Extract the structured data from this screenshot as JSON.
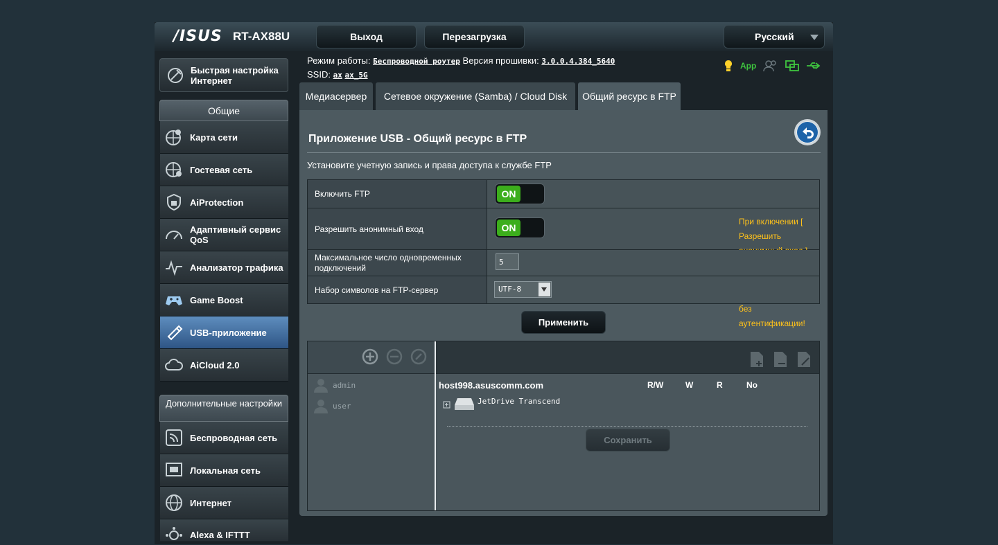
{
  "header": {
    "brand": "/ISUS",
    "model": "RT-AX88U",
    "logout": "Выход",
    "reboot": "Перезагрузка",
    "language": "Русский"
  },
  "info": {
    "mode_label": "Режим работы:",
    "mode_value": "Беспроводной роутер",
    "fw_label": "Версия прошивки:",
    "fw_value": "3.0.0.4.384_5640",
    "ssid_label": "SSID:",
    "ssid_1": "ax",
    "ssid_2": "ax_5G",
    "app": "App"
  },
  "sidebar": {
    "quick_setup": "Быстрая настройка Интернет",
    "general_header": "Общие",
    "general_items": [
      {
        "label": "Карта сети",
        "icon": "network-map-icon"
      },
      {
        "label": "Гостевая сеть",
        "icon": "guest-network-icon"
      },
      {
        "label": "AiProtection",
        "icon": "shield-icon"
      },
      {
        "label": "Адаптивный сервис QoS",
        "icon": "qos-gauge-icon"
      },
      {
        "label": "Анализатор трафика",
        "icon": "traffic-analyzer-icon"
      },
      {
        "label": "Game Boost",
        "icon": "gamepad-icon"
      },
      {
        "label": "USB-приложение",
        "icon": "usb-icon"
      },
      {
        "label": "AiCloud 2.0",
        "icon": "cloud-icon"
      }
    ],
    "advanced_header": "Дополнительные настройки",
    "advanced_items": [
      {
        "label": "Беспроводная сеть",
        "icon": "wireless-icon"
      },
      {
        "label": "Локальная сеть",
        "icon": "lan-icon"
      },
      {
        "label": "Интернет",
        "icon": "globe-icon"
      },
      {
        "label": "Alexa & IFTTT",
        "icon": "alexa-icon"
      }
    ]
  },
  "tabs": [
    "Медиасервер",
    "Сетевое окружение (Samba) / Cloud Disk",
    "Общий ресурс в FTP"
  ],
  "main": {
    "title": "Приложение USB - Общий ресурс в FTP",
    "description": "Установите учетную запись и права доступа к службе FTP",
    "rows": {
      "enable_ftp": "Включить FTP",
      "anon_login": "Разрешить анонимный вход",
      "max_conn": "Максимальное число одновременных подключений",
      "charset": "Набор символов на FTP-сервер"
    },
    "toggle_on": "ON",
    "warning_line1": "При включении [ Разрешить анонимный вход ] любой",
    "warning_line2": "пользователь может подключиться к FTP без аутентификации!",
    "max_conn_value": "5",
    "charset_value": "UTF-8",
    "apply": "Применить"
  },
  "accounts": {
    "users": [
      "admin",
      "user"
    ],
    "host": "host998.asuscomm.com",
    "perms": [
      "R/W",
      "W",
      "R",
      "No"
    ],
    "drive": "JetDrive Transcend",
    "save": "Сохранить"
  },
  "colors": {
    "accent_green": "#3cae1c",
    "warning": "#ffc21a",
    "active_menu": "#4a78ac"
  }
}
